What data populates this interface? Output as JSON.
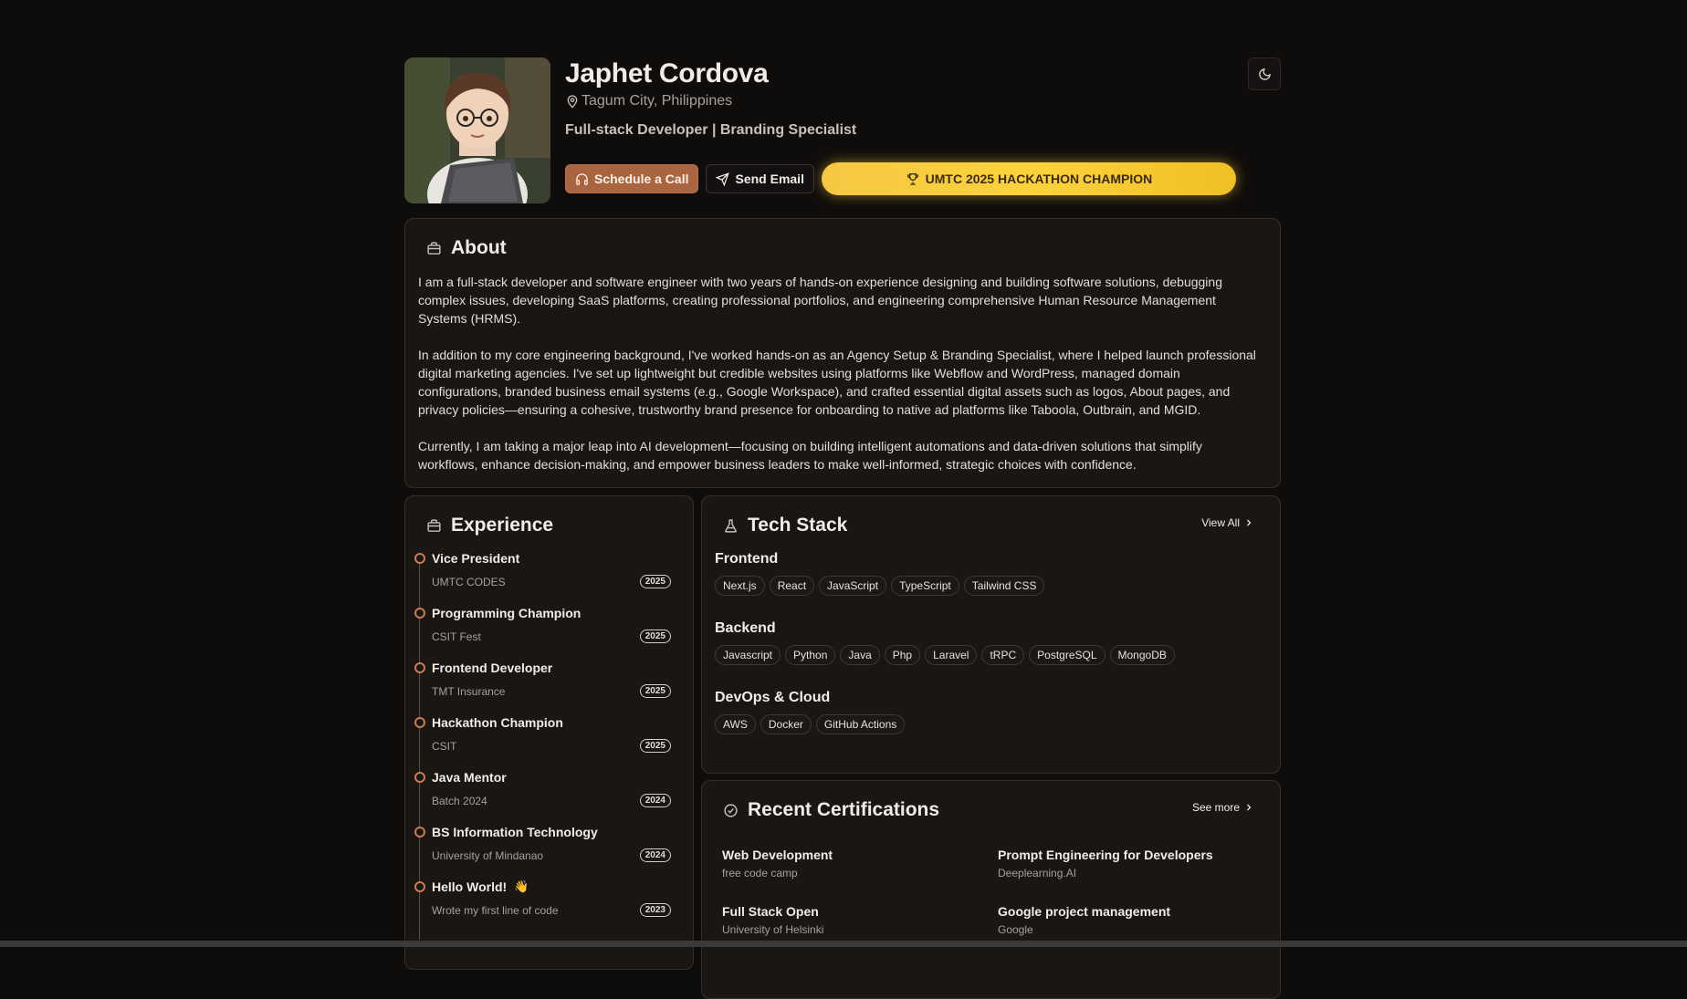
{
  "profile": {
    "name": "Japhet Cordova",
    "location": "Tagum City, Philippines",
    "role": "Full-stack Developer | Branding Specialist",
    "schedule_label": "Schedule a Call",
    "email_label": "Send Email",
    "champion_label": "UMTC 2025 HACKATHON CHAMPION"
  },
  "about": {
    "title": "About",
    "paragraphs": [
      "I am a full-stack developer and software engineer with two years of hands-on experience designing and building software solutions, debugging complex issues, developing SaaS platforms, creating professional portfolios, and engineering comprehensive Human Resource Management Systems (HRMS).",
      "In addition to my core engineering background, I've worked hands-on as an Agency Setup & Branding Specialist, where I helped launch professional digital marketing agencies. I've set up lightweight but credible websites using platforms like Webflow and WordPress, managed domain configurations, branded business email systems (e.g., Google Workspace), and crafted essential digital assets such as logos, About pages, and privacy policies—ensuring a cohesive, trustworthy brand presence for onboarding to native ad platforms like Taboola, Outbrain, and MGID.",
      "Currently, I am taking a major leap into AI development—focusing on building intelligent automations and data-driven solutions that simplify workflows, enhance decision-making, and empower business leaders to make well-informed, strategic choices with confidence."
    ]
  },
  "experience": {
    "title": "Experience",
    "items": [
      {
        "title": "Vice President",
        "org": "UMTC CODES",
        "year": "2025"
      },
      {
        "title": "Programming Champion",
        "org": "CSIT Fest",
        "year": "2025"
      },
      {
        "title": "Frontend Developer",
        "org": "TMT Insurance",
        "year": "2025"
      },
      {
        "title": "Hackathon Champion",
        "org": "CSIT",
        "year": "2025"
      },
      {
        "title": "Java Mentor",
        "org": "Batch 2024",
        "year": "2024"
      },
      {
        "title": "BS Information Technology",
        "org": "University of Mindanao",
        "year": "2024"
      },
      {
        "title": "Hello World!",
        "emoji": "👋",
        "org": "Wrote my first line of code",
        "year": "2023"
      }
    ]
  },
  "tech": {
    "title": "Tech Stack",
    "view_all": "View All",
    "groups": [
      {
        "name": "Frontend",
        "tags": [
          "Next.js",
          "React",
          "JavaScript",
          "TypeScript",
          "Tailwind CSS"
        ]
      },
      {
        "name": "Backend",
        "tags": [
          "Javascript",
          "Python",
          "Java",
          "Php",
          "Laravel",
          "tRPC",
          "PostgreSQL",
          "MongoDB"
        ]
      },
      {
        "name": "DevOps & Cloud",
        "tags": [
          "AWS",
          "Docker",
          "GitHub Actions"
        ]
      }
    ]
  },
  "certs": {
    "title": "Recent Certifications",
    "see_more": "See more",
    "items": [
      {
        "title": "Web Development",
        "issuer": "free code camp"
      },
      {
        "title": "Prompt Engineering for Developers",
        "issuer": "Deeplearning.AI"
      },
      {
        "title": "Full Stack Open",
        "issuer": "University of Helsinki"
      },
      {
        "title": "Google project management",
        "issuer": "Google"
      }
    ]
  },
  "colors": {
    "background": "#0f0d0c",
    "card": "#1a1614",
    "accent": "#a8653f",
    "champion": "#fcd23c"
  }
}
